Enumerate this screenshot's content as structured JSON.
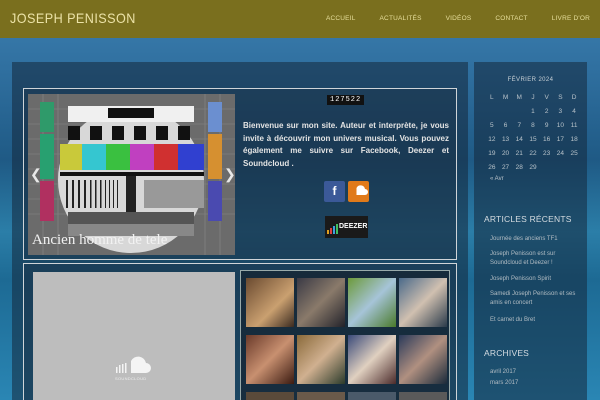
{
  "header": {
    "brand": "JOSEPH PENISSON",
    "nav": [
      "ACCUEIL",
      "ACTUALITÉS",
      "VIDÉOS",
      "CONTACT",
      "LIVRE D'OR"
    ]
  },
  "slider": {
    "caption": "Ancien homme de tele",
    "prev_arrow": "❮",
    "next_arrow": "❯"
  },
  "counter": "127522",
  "welcome_text": "Bienvenue sur mon site. Auteur et interprète, je vous invite à découvrir mon univers musical. Vous pouvez également me suivre sur Facebook, Deezer et Soundcloud .",
  "social": {
    "facebook": "f",
    "deezer": "DEEZER"
  },
  "soundcloud_label": "SOUNDCLOUD",
  "calendar": {
    "title": "FÉVRIER 2024",
    "days": [
      "L",
      "M",
      "M",
      "J",
      "V",
      "S",
      "D"
    ],
    "weeks": [
      [
        "",
        "",
        "",
        "1",
        "2",
        "3",
        "4"
      ],
      [
        "5",
        "6",
        "7",
        "8",
        "9",
        "10",
        "11"
      ],
      [
        "12",
        "13",
        "14",
        "15",
        "16",
        "17",
        "18"
      ],
      [
        "19",
        "20",
        "21",
        "22",
        "23",
        "24",
        "25"
      ],
      [
        "26",
        "27",
        "28",
        "29",
        "",
        "",
        ""
      ]
    ],
    "prev": "« Avr"
  },
  "recent": {
    "title": "ARTICLES RÉCENTS",
    "items": [
      "Journée des anciens TF1",
      "Joseph Penisson est sur Soundcloud et Deezer !",
      "Joseph Penisson Spirit",
      "Samedi Joseph Penisson et ses amis en concert",
      "Et carnet du Bret"
    ]
  },
  "archives": {
    "title": "ARCHIVES",
    "items": [
      "avril 2017",
      "mars 2017"
    ]
  }
}
